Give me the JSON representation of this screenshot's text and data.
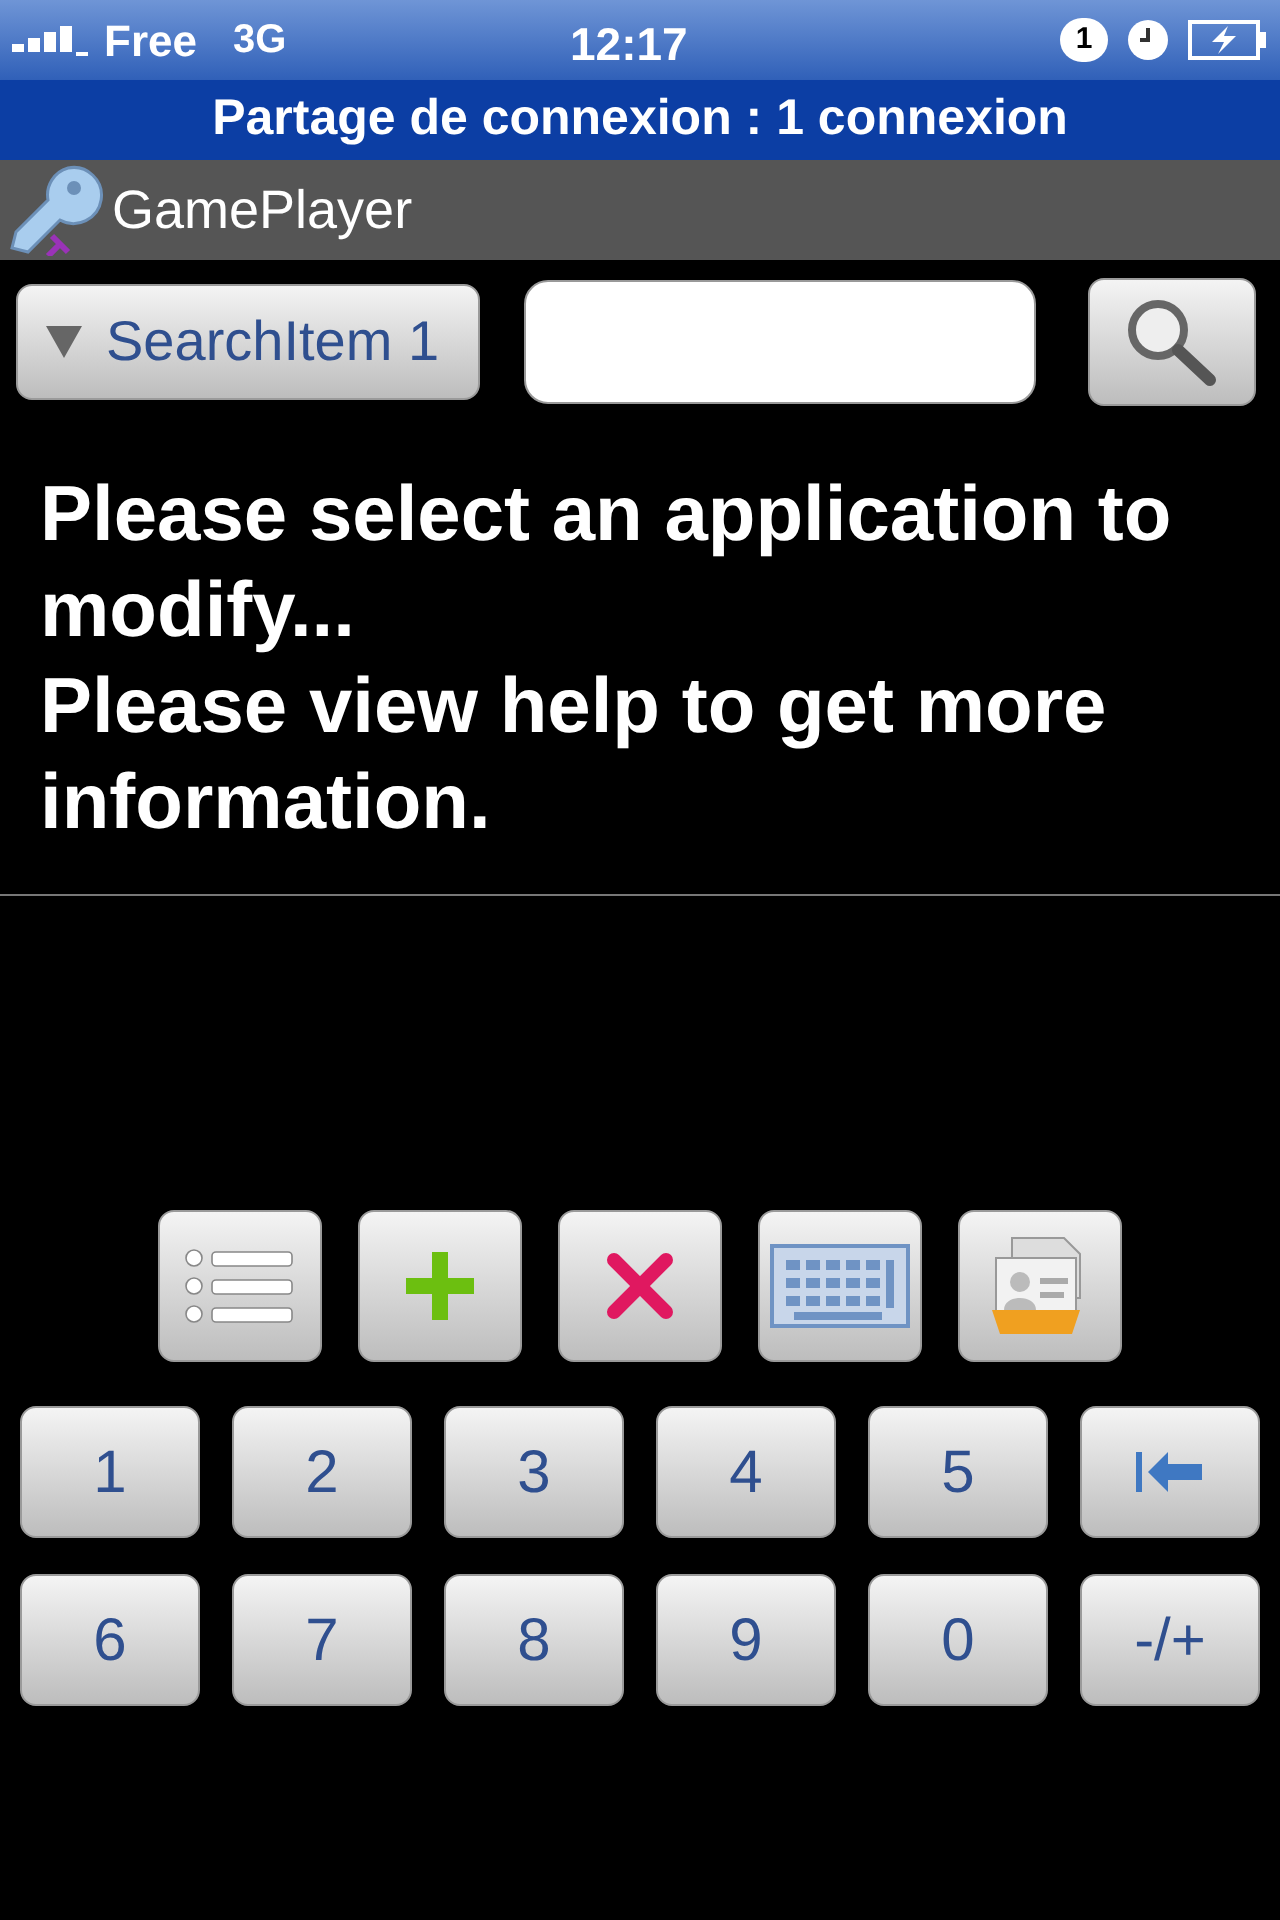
{
  "status_bar": {
    "carrier": "Free",
    "network": "3G",
    "time": "12:17",
    "notification_count": "1"
  },
  "banner": {
    "text": "Partage de connexion : 1 connexion"
  },
  "app_bar": {
    "title": "GamePlayer"
  },
  "search": {
    "dropdown": "SearchItem 1"
  },
  "message": [
    "Please select an application to modify...",
    "Please view help to get more information."
  ],
  "toolbar": [
    {
      "kind": "list"
    },
    {
      "kind": "add"
    },
    {
      "kind": "delete"
    },
    {
      "kind": "keyboard"
    },
    {
      "kind": "contacts"
    }
  ],
  "keypad": [
    [
      {
        "kind": "text",
        "label": "1"
      },
      {
        "kind": "text",
        "label": "2"
      },
      {
        "kind": "text",
        "label": "3"
      },
      {
        "kind": "text",
        "label": "4"
      },
      {
        "kind": "text",
        "label": "5"
      },
      {
        "kind": "backspace"
      }
    ],
    [
      {
        "kind": "text",
        "label": "6"
      },
      {
        "kind": "text",
        "label": "7"
      },
      {
        "kind": "text",
        "label": "8"
      },
      {
        "kind": "text",
        "label": "9"
      },
      {
        "kind": "text",
        "label": "0"
      },
      {
        "kind": "text",
        "label": "-/+"
      }
    ]
  ]
}
